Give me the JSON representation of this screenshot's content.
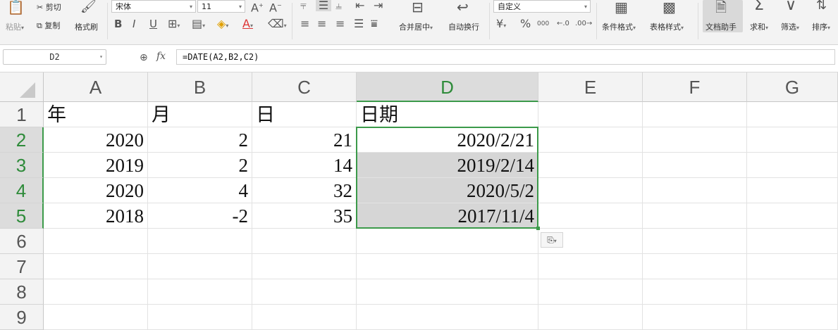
{
  "toolbar": {
    "paste_label": "粘贴",
    "cut_label": "剪切",
    "copy_label": "复制",
    "format_painter_label": "格式刷",
    "font_name": "宋体",
    "font_size": "11",
    "merge_center_label": "合并居中",
    "wrap_text_label": "自动换行",
    "number_format": "自定义",
    "conditional_format_label": "条件格式",
    "table_style_label": "表格样式",
    "doc_assistant_label": "文档助手",
    "sum_label": "求和",
    "filter_label": "筛选",
    "sort_label": "排序",
    "bold": "B",
    "italic": "I",
    "underline": "U",
    "percent": "%",
    "thousands": "000",
    "fx": "fx"
  },
  "formula_bar": {
    "name_box": "D2",
    "formula": "=DATE(A2,B2,C2)"
  },
  "columns": [
    "A",
    "B",
    "C",
    "D",
    "E",
    "F",
    "G"
  ],
  "rows": [
    "1",
    "2",
    "3",
    "4",
    "5",
    "6",
    "7",
    "8",
    "9"
  ],
  "cells": {
    "A1": "年",
    "B1": "月",
    "C1": "日",
    "D1": "日期",
    "A2": "2020",
    "B2": "2",
    "C2": "21",
    "D2": "2020/2/21",
    "A3": "2019",
    "B3": "2",
    "C3": "14",
    "D3": "2019/2/14",
    "A4": "2020",
    "B4": "4",
    "C4": "32",
    "D4": "2020/5/2",
    "A5": "2018",
    "B5": "-2",
    "C5": "35",
    "D5": "2017/11/4"
  },
  "colors": {
    "selection_green": "#3c9a4a",
    "selected_header": "#dcdcdc"
  }
}
